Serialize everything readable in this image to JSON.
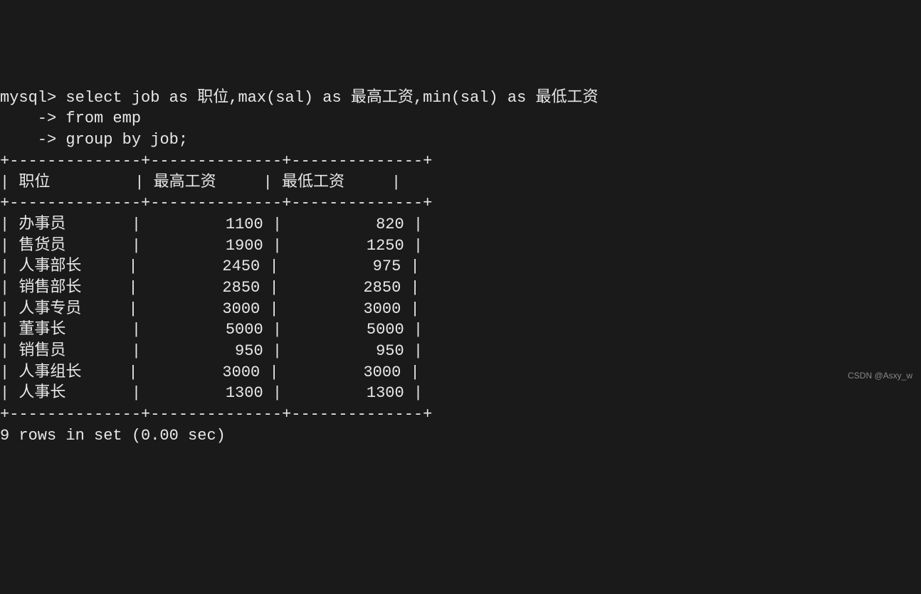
{
  "prompt_mysql": "mysql>",
  "prompt_cont": "    ->",
  "query_line1": " select job as 职位,max(sal) as 最高工资,min(sal) as 最低工资",
  "query_line2": " from emp",
  "query_line3": " group by job;",
  "border": "+--------------+--------------+--------------+",
  "headers": {
    "c1": "职位",
    "c2": "最高工资",
    "c3": "最低工资"
  },
  "rows": [
    {
      "c1": "办事员",
      "c2": "1100",
      "c3": "820"
    },
    {
      "c1": "售货员",
      "c2": "1900",
      "c3": "1250"
    },
    {
      "c1": "人事部长",
      "c2": "2450",
      "c3": "975"
    },
    {
      "c1": "销售部长",
      "c2": "2850",
      "c3": "2850"
    },
    {
      "c1": "人事专员",
      "c2": "3000",
      "c3": "3000"
    },
    {
      "c1": "董事长",
      "c2": "5000",
      "c3": "5000"
    },
    {
      "c1": "销售员",
      "c2": "950",
      "c3": "950"
    },
    {
      "c1": "人事组长",
      "c2": "3000",
      "c3": "3000"
    },
    {
      "c1": "人事长",
      "c2": "1300",
      "c3": "1300"
    }
  ],
  "footer": "9 rows in set (0.00 sec)",
  "watermark": "CSDN @Asxy_w",
  "chart_data": {
    "type": "table",
    "title": "",
    "columns": [
      "职位",
      "最高工资",
      "最低工资"
    ],
    "data": [
      [
        "办事员",
        1100,
        820
      ],
      [
        "售货员",
        1900,
        1250
      ],
      [
        "人事部长",
        2450,
        975
      ],
      [
        "销售部长",
        2850,
        2850
      ],
      [
        "人事专员",
        3000,
        3000
      ],
      [
        "董事长",
        5000,
        5000
      ],
      [
        "销售员",
        950,
        950
      ],
      [
        "人事组长",
        3000,
        3000
      ],
      [
        "人事长",
        1300,
        1300
      ]
    ]
  }
}
